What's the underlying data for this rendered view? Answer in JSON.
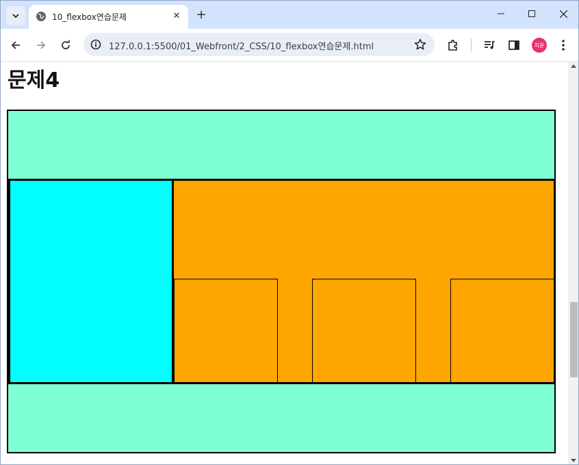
{
  "browser": {
    "tab": {
      "title": "10_flexbox연습문제",
      "close_label": "✕"
    },
    "new_tab_label": "+",
    "url": "127.0.0.1:5500/01_Webfront/2_CSS/10_flexbox연습문제.html",
    "profile_initials": "지윤",
    "window_controls": {
      "minimize": "—",
      "maximize": "☐",
      "close": "✕"
    }
  },
  "page": {
    "heading": "문제4"
  },
  "colors": {
    "header_footer": "#7fffd4",
    "left_panel": "#00ffff",
    "right_panel": "#ffa500",
    "profile": "#e8336c",
    "tabstrip": "#d3e3fd"
  },
  "icons": {
    "tab_search": "chevron-down-icon",
    "favicon": "globe-icon",
    "back": "arrow-left-icon",
    "forward": "arrow-right-icon",
    "reload": "reload-icon",
    "site_info": "info-icon",
    "bookmark": "star-icon",
    "extensions": "puzzle-icon",
    "media": "media-queue-icon",
    "side_panel": "side-panel-icon",
    "menu": "kebab-menu-icon"
  },
  "layout_boxes": {
    "inner_box_count": 3
  }
}
